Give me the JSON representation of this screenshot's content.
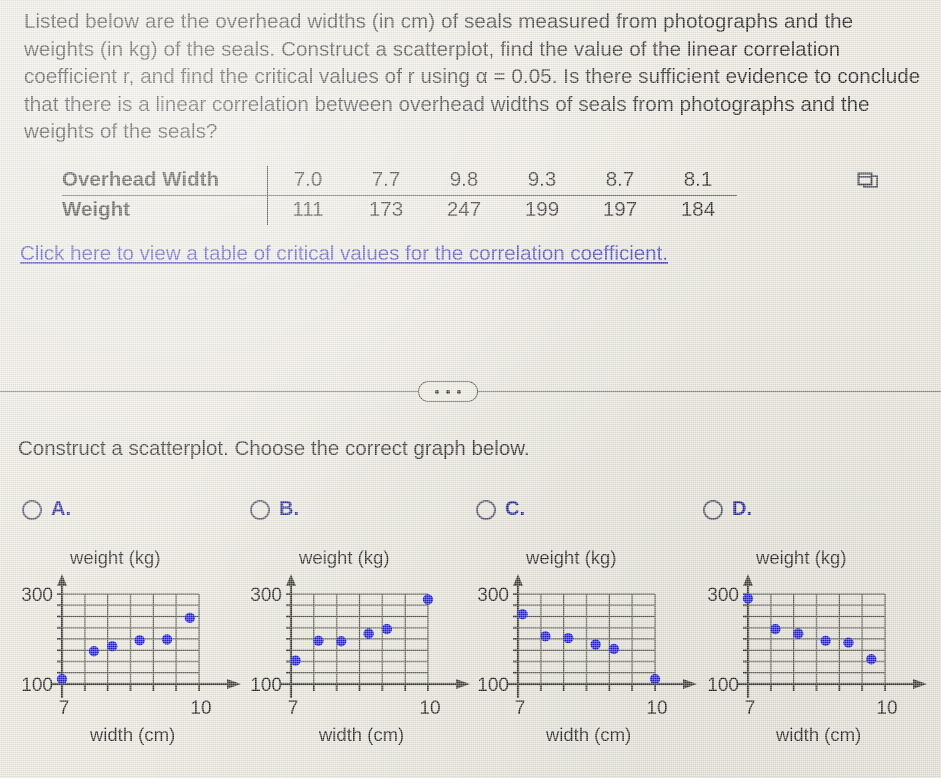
{
  "problem": {
    "text": "Listed below are the overhead widths (in cm) of seals measured from photographs and the weights (in kg) of the seals. Construct a scatterplot, find the value of the linear correlation coefficient r, and find the critical values of r using α = 0.05. Is there sufficient evidence to conclude that there is a linear correlation between overhead widths of seals from photographs and the weights of the seals?"
  },
  "data_table": {
    "row1_label": "Overhead Width",
    "row2_label": "Weight",
    "widths": [
      "7.0",
      "7.7",
      "9.8",
      "9.3",
      "8.7",
      "8.1"
    ],
    "weights": [
      "111",
      "173",
      "247",
      "199",
      "197",
      "184"
    ],
    "copy_icon": "copy-window-icon"
  },
  "critical_values_link": "Click here to view a table of critical values for the correlation coefficient.",
  "divider": {
    "ellipsis_icon": "ellipsis-dots-icon"
  },
  "subprompt": "Construct a scatterplot. Choose the correct graph below.",
  "colors": {
    "background": "#e9e7dd",
    "text": "#20201e",
    "link": "#3b3bb5",
    "choice_label": "#21218e",
    "point": "#2020c8",
    "axis": "#3a3933",
    "grid": "#5b5a52"
  },
  "choices": [
    {
      "id": "A",
      "label": "A.",
      "selected": false
    },
    {
      "id": "B",
      "label": "B.",
      "selected": false
    },
    {
      "id": "C",
      "label": "C.",
      "selected": false
    },
    {
      "id": "D",
      "label": "D.",
      "selected": false
    }
  ],
  "chart_data": [
    {
      "id": "A",
      "type": "scatter",
      "title": "",
      "xlabel": "width (cm)",
      "ylabel": "weight (kg)",
      "xlim": [
        7,
        10
      ],
      "ylim": [
        100,
        300
      ],
      "xticklabels": [
        "7",
        "10"
      ],
      "yticklabels": [
        "300",
        "100"
      ],
      "grid": true,
      "x": [
        7.0,
        7.7,
        8.1,
        8.7,
        9.3,
        9.8
      ],
      "y": [
        111,
        173,
        184,
        197,
        199,
        247
      ]
    },
    {
      "id": "B",
      "type": "scatter",
      "title": "",
      "xlabel": "width (cm)",
      "ylabel": "weight (kg)",
      "xlim": [
        7,
        10
      ],
      "ylim": [
        100,
        300
      ],
      "xticklabels": [
        "7",
        "10"
      ],
      "yticklabels": [
        "300",
        "100"
      ],
      "grid": true,
      "x": [
        7.1,
        7.6,
        8.1,
        8.7,
        9.1,
        10.0
      ],
      "y": [
        152,
        196,
        195,
        212,
        222,
        288
      ]
    },
    {
      "id": "C",
      "type": "scatter",
      "title": "",
      "xlabel": "width (cm)",
      "ylabel": "weight (kg)",
      "xlim": [
        7,
        10
      ],
      "ylim": [
        100,
        300
      ],
      "xticklabels": [
        "7",
        "10"
      ],
      "yticklabels": [
        "300",
        "100"
      ],
      "grid": true,
      "x": [
        7.1,
        7.6,
        8.1,
        8.7,
        9.1,
        10.0
      ],
      "y": [
        255,
        206,
        202,
        188,
        178,
        111
      ]
    },
    {
      "id": "D",
      "type": "scatter",
      "title": "",
      "xlabel": "width (cm)",
      "ylabel": "weight (kg)",
      "xlim": [
        7,
        10
      ],
      "ylim": [
        100,
        300
      ],
      "xticklabels": [
        "7",
        "10"
      ],
      "yticklabels": [
        "300",
        "100"
      ],
      "grid": true,
      "x": [
        7.0,
        7.6,
        8.1,
        8.7,
        9.2,
        9.7
      ],
      "y": [
        290,
        222,
        212,
        196,
        192,
        155
      ]
    }
  ]
}
